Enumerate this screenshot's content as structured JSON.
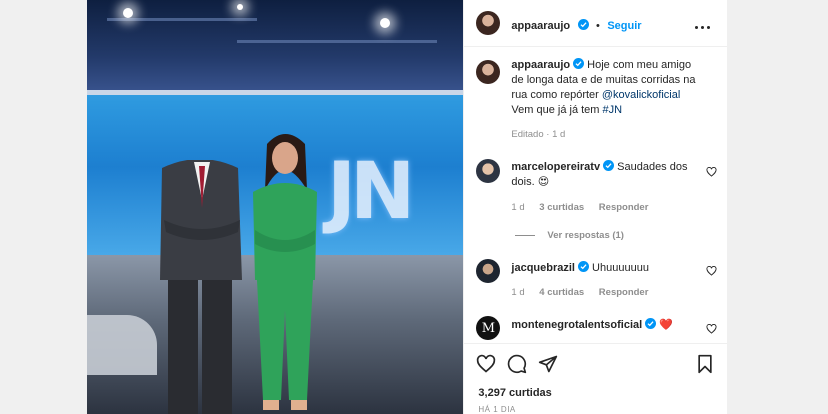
{
  "post": {
    "author": "appaaraujo",
    "separator": "•",
    "follow_label": "Seguir",
    "caption": {
      "line1": "Hoje com meu amigo",
      "line2": "de longa data e de muitas corridas na",
      "line3_prefix": "rua como repórter ",
      "mention": "@kovalickoficial",
      "line4_prefix": "Vem que já já tem ",
      "hashtag": "#JN"
    },
    "edited": "Editado · 1 d"
  },
  "photo": {
    "logo_text": "JN"
  },
  "comments": [
    {
      "user": "marcelopereiratv",
      "text": "Saudades dos",
      "text2": "dois. 😍",
      "time": "1 d",
      "likes": "3 curtidas",
      "reply": "Responder",
      "view_replies": "Ver respostas (1)"
    },
    {
      "user": "jacquebrazil",
      "text": "Uhuuuuuuu",
      "time": "1 d",
      "likes": "4 curtidas",
      "reply": "Responder"
    },
    {
      "user": "montenegrotalentsoficial",
      "text": "❤️",
      "avatar_letter": "M"
    }
  ],
  "footer": {
    "likes": "3,297 curtidas",
    "timestamp": "HÁ 1 DIA"
  },
  "colors": {
    "accent": "#0095f6",
    "link": "#00376b",
    "muted": "#8e8e8e",
    "heart": "#ed4956"
  },
  "icons": [
    "heart-icon",
    "comment-icon",
    "share-icon",
    "bookmark-icon",
    "more-icon",
    "verified-icon"
  ]
}
